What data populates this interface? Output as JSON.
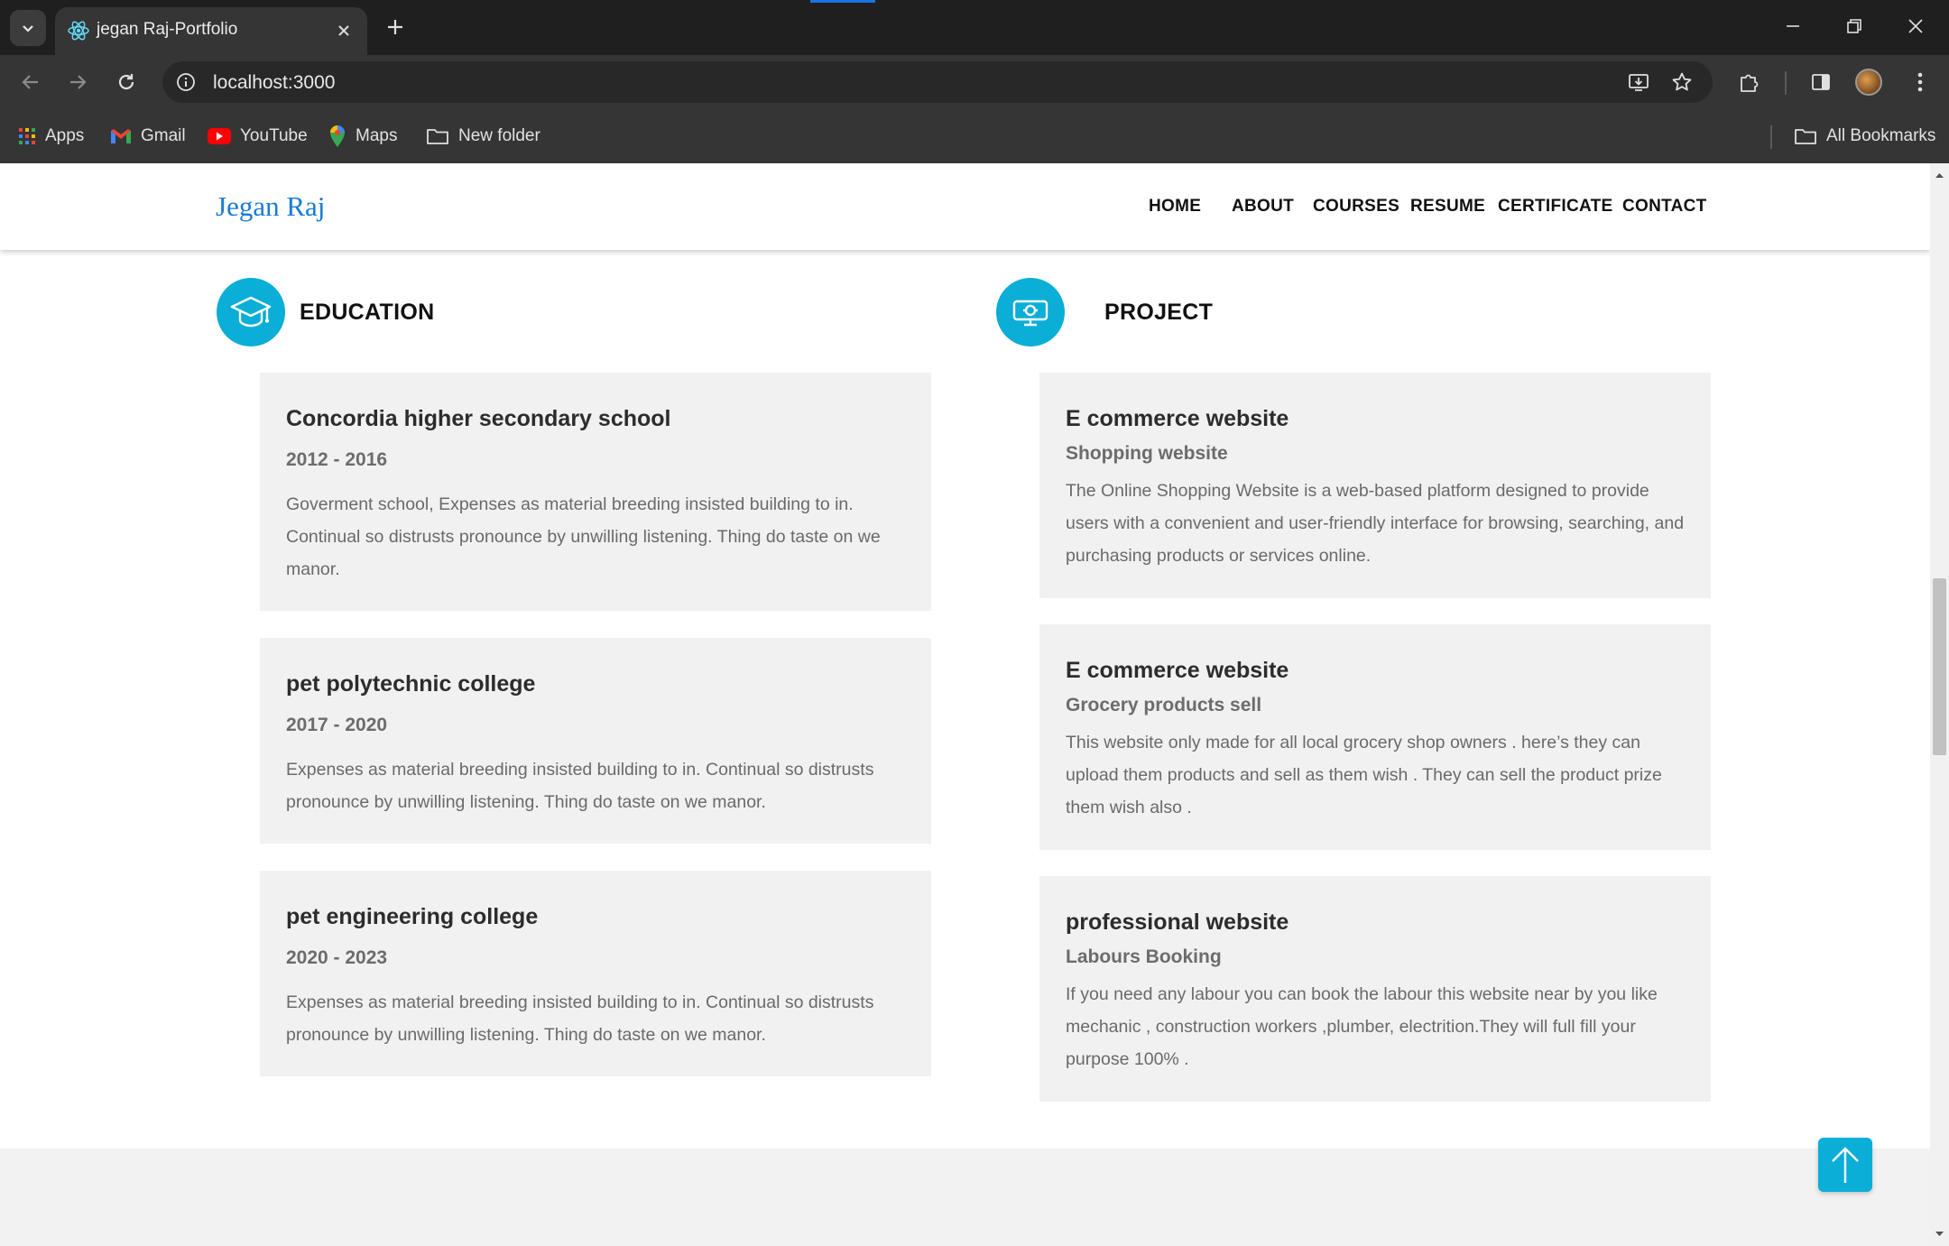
{
  "browser": {
    "tab_title": "jegan Raj-Portfolio",
    "url": "localhost:3000",
    "bookmarks": [
      {
        "label": "Apps",
        "icon": "apps-grid-icon"
      },
      {
        "label": "Gmail",
        "icon": "gmail-icon"
      },
      {
        "label": "YouTube",
        "icon": "youtube-icon"
      },
      {
        "label": "Maps",
        "icon": "maps-icon"
      },
      {
        "label": "New folder",
        "icon": "folder-icon"
      }
    ],
    "all_bookmarks": "All Bookmarks"
  },
  "site": {
    "logo": "Jegan Raj",
    "nav": [
      "HOME",
      "ABOUT",
      "COURSES",
      "RESUME",
      "CERTIFICATE",
      "CONTACT"
    ],
    "accent_color": "#0aaed6",
    "logo_color": "#1a7bd6"
  },
  "education": {
    "title": "EDUCATION",
    "icon": "graduation-cap-icon",
    "items": [
      {
        "school": "Concordia higher secondary school",
        "years": "2012 - 2016",
        "text": "Goverment school, Expenses as material breeding insisted building to in. Continual so distrusts pronounce by unwilling listening. Thing do taste on we manor."
      },
      {
        "school": "pet polytechnic college",
        "years": "2017 - 2020",
        "text": "Expenses as material breeding insisted building to in. Continual so distrusts pronounce by unwilling listening. Thing do taste on we manor."
      },
      {
        "school": "pet engineering college",
        "years": "2020 - 2023",
        "text": "Expenses as material breeding insisted building to in. Continual so distrusts pronounce by unwilling listening. Thing do taste on we manor."
      }
    ]
  },
  "project": {
    "title": "PROJECT",
    "icon": "presentation-screen-icon",
    "items": [
      {
        "name": "E commerce website",
        "subtitle": "Shopping website",
        "text": "The Online Shopping Website is a web-based platform designed to provide users with a convenient and user-friendly interface for browsing, searching, and purchasing products or services online."
      },
      {
        "name": "E commerce website",
        "subtitle": "Grocery products sell",
        "text": "This website only made for all local grocery shop owners . here’s they can upload them products and sell as them wish . They can sell the product prize them wish also ."
      },
      {
        "name": "professional website",
        "subtitle": "Labours Booking",
        "text": "If you need any labour you can book the labour this website near by you like mechanic , construction workers ,plumber, electrition.They will full fill your purpose 100% ."
      }
    ]
  }
}
